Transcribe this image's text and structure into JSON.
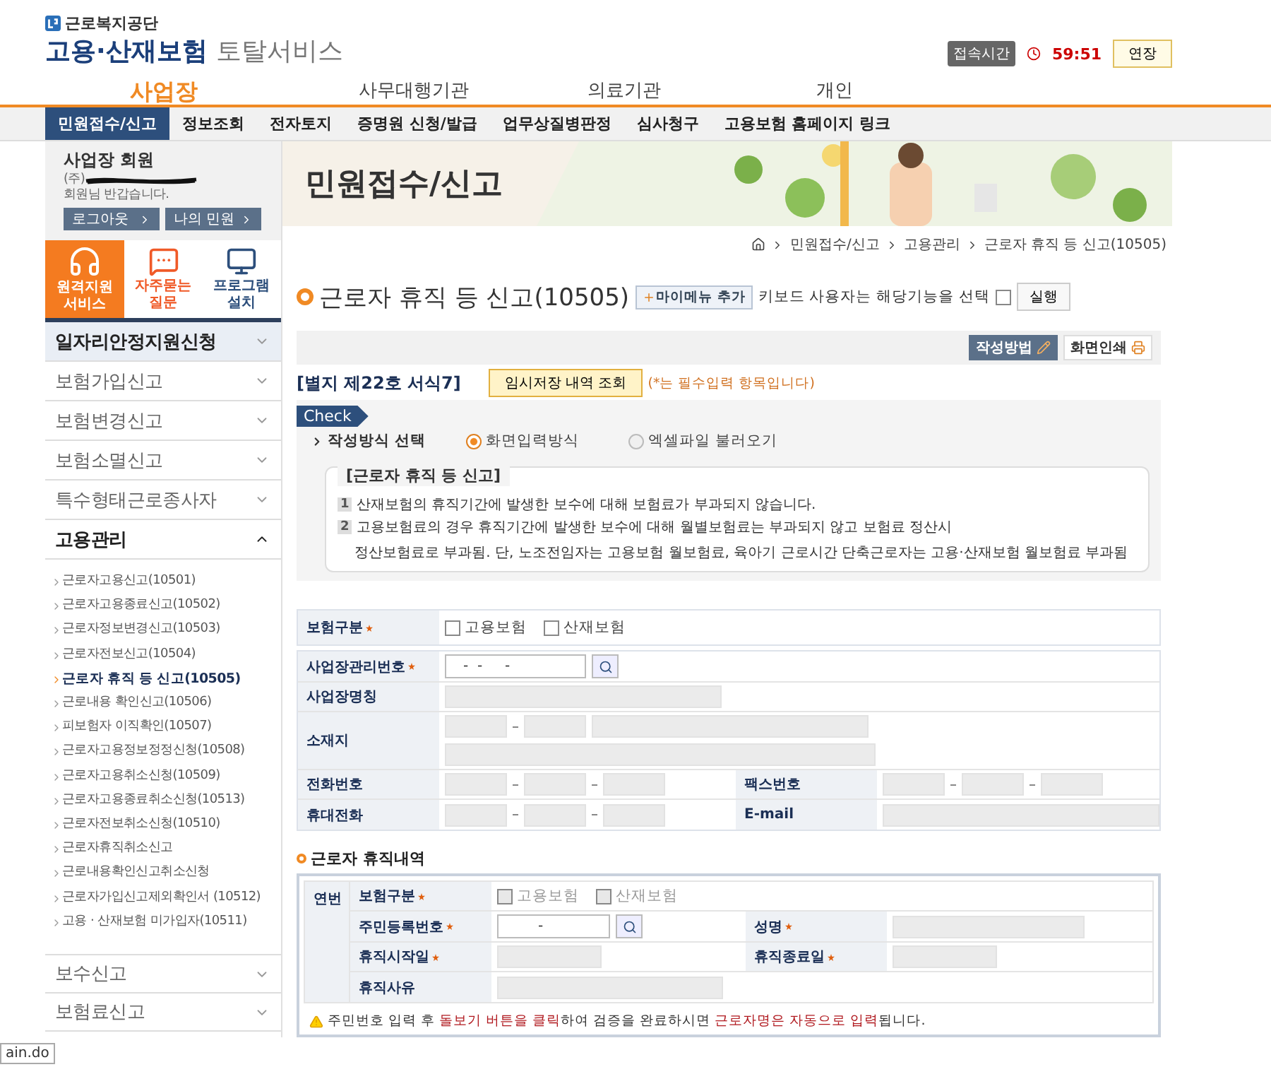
{
  "header": {
    "org": "근로복지공단",
    "service_main": "고용·산재보험",
    "service_sub": "토탈서비스",
    "session_label": "접속시간",
    "session_time": "59:51",
    "extend_button": "연장"
  },
  "top_nav": [
    {
      "label": "사업장",
      "selected": true
    },
    {
      "label": "사무대행기관",
      "selected": false
    },
    {
      "label": "의료기관",
      "selected": false
    },
    {
      "label": "개인",
      "selected": false
    }
  ],
  "sub_nav": [
    {
      "label": "민원접수/신고",
      "selected": true
    },
    {
      "label": "정보조회",
      "selected": false
    },
    {
      "label": "전자토지",
      "selected": false
    },
    {
      "label": "증명원 신청/발급",
      "selected": false
    },
    {
      "label": "업무상질병판정",
      "selected": false
    },
    {
      "label": "심사청구",
      "selected": false
    },
    {
      "label": "고용보험 홈페이지 링크",
      "selected": false
    }
  ],
  "user_box": {
    "title": "사업장 회원",
    "prefix": "(주)",
    "greeting": "회원님 반갑습니다.",
    "buttons": [
      "로그아웃",
      "나의 민원"
    ]
  },
  "quick_links": [
    {
      "kind": "headset",
      "label": "원격지원\n서비스",
      "selected": true
    },
    {
      "kind": "chat",
      "label": "자주묻는\n질문",
      "selected": false
    },
    {
      "kind": "monitor",
      "label": "프로그램\n설치",
      "selected": false
    }
  ],
  "menu": [
    {
      "label": "일자리안정지원신청",
      "selected": true,
      "expanded": false
    },
    {
      "label": "보험가입신고",
      "selected": false,
      "expanded": false
    },
    {
      "label": "보험변경신고",
      "selected": false,
      "expanded": false
    },
    {
      "label": "보험소멸신고",
      "selected": false,
      "expanded": false
    },
    {
      "label": "특수형태근로종사자",
      "selected": false,
      "expanded": false
    },
    {
      "label": "고용관리",
      "selected": false,
      "expanded": true,
      "children": [
        {
          "label": "근로자고용신고(10501)",
          "selected": false
        },
        {
          "label": "근로자고용종료신고(10502)",
          "selected": false
        },
        {
          "label": "근로자정보변경신고(10503)",
          "selected": false
        },
        {
          "label": "근로자전보신고(10504)",
          "selected": false
        },
        {
          "label": "근로자 휴직 등 신고(10505)",
          "selected": true
        },
        {
          "label": "근로내용 확인신고(10506)",
          "selected": false
        },
        {
          "label": "피보험자 이직확인(10507)",
          "selected": false
        },
        {
          "label": "근로자고용정보정정신청(10508)",
          "selected": false
        },
        {
          "label": "근로자고용취소신청(10509)",
          "selected": false
        },
        {
          "label": "근로자고용종료취소신청(10513)",
          "selected": false
        },
        {
          "label": "근로자전보취소신청(10510)",
          "selected": false
        },
        {
          "label": "근로자휴직취소신고",
          "selected": false
        },
        {
          "label": "근로내용확인신고취소신청",
          "selected": false
        },
        {
          "label": "근로자가입신고제외확인서 (10512)",
          "selected": false
        },
        {
          "label": "고용 · 산재보험 미가입자(10511)",
          "selected": false
        }
      ]
    },
    {
      "label": "보수신고",
      "selected": false,
      "expanded": false
    },
    {
      "label": "보험료신고",
      "selected": false,
      "expanded": false
    }
  ],
  "banner": {
    "title": "민원접수/신고"
  },
  "breadcrumb": [
    "민원접수/신고",
    "고용관리",
    "근로자 휴직 등 신고(10505)"
  ],
  "page_title": "근로자 휴직 등 신고(10505)",
  "mymenu_button": "마이메뉴 추가",
  "keyboard_label": "키보드 사용자는 해당기능을 선택",
  "keyboard_checked": false,
  "run_button": "실행",
  "tools": [
    {
      "kind": "guide",
      "label": "작성방법"
    },
    {
      "kind": "print",
      "label": "화면인쇄"
    }
  ],
  "form_no": "[별지 제22호 서식7]",
  "temp_button": "임시저장 내역 조회",
  "required_note": "(*는 필수입력 항목입니다)",
  "check": {
    "tag": "Check",
    "label": "작성방식 선택",
    "options": [
      {
        "label": "화면입력방식",
        "selected": true
      },
      {
        "label": "엑셀파일 불러오기",
        "selected": false
      }
    ],
    "notice_title": "[근로자 휴직 등 신고]",
    "notes": [
      {
        "number": "1",
        "text": "산재보험의 휴직기간에 발생한 보수에 대해 보험료가 부과되지 않습니다."
      },
      {
        "number": "2",
        "text": "고용보험료의 경우 휴직기간에 발생한 보수에 대해 월별보험료는 부과되지 않고 보험료 정산시",
        "continuation": "정산보험료로 부과됨. 단, 노조전임자는 고용보험 월보험료, 육아기 근로시간 단축근로자는 고용·산재보험 월보험료 부과됨"
      }
    ]
  },
  "employer": {
    "insurance": {
      "label": "보험구분",
      "required": true,
      "options": [
        {
          "label": "고용보험",
          "checked": false
        },
        {
          "label": "산재보험",
          "checked": false
        }
      ]
    },
    "mgmt_no": {
      "label": "사업장관리번호",
      "required": true,
      "value": "-  -     -"
    },
    "name": {
      "label": "사업장명칭"
    },
    "address": {
      "label": "소재지"
    },
    "phone": {
      "label": "전화번호"
    },
    "fax": {
      "label": "팩스번호"
    },
    "mobile": {
      "label": "휴대전화"
    },
    "email": {
      "label": "E-mail"
    }
  },
  "leave": {
    "title": "근로자 휴직내역",
    "col_no": "연번",
    "insurance": {
      "label": "보험구분",
      "required": true,
      "options": [
        {
          "label": "고용보험",
          "checked": false
        },
        {
          "label": "산재보험",
          "checked": false
        }
      ]
    },
    "rrn": {
      "label": "주민등록번호",
      "required": true,
      "value": "-"
    },
    "name": {
      "label": "성명",
      "required": true
    },
    "start": {
      "label": "휴직시작일",
      "required": true
    },
    "end": {
      "label": "휴직종료일",
      "required": true
    },
    "reason": {
      "label": "휴직사유"
    }
  },
  "notice": "주민번호 입력 후 **돌보기 버튼을 클릭**하여 검증을 완료하시면 **근로자명은 자동으로 입력**됩니다.",
  "status_url": "ain.do"
}
